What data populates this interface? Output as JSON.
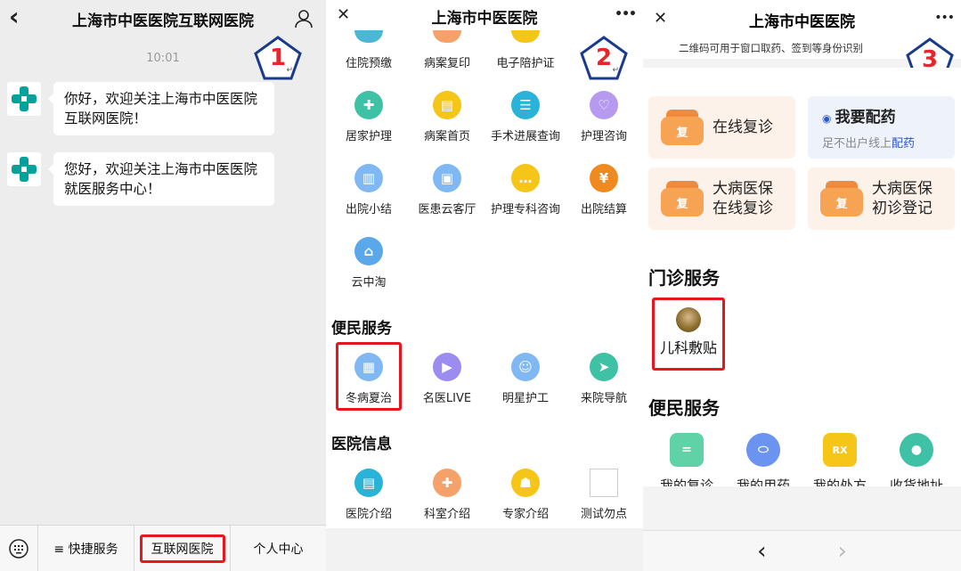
{
  "panel1": {
    "title": "上海市中医医院互联网医院",
    "back_icon": "‹",
    "user_icon": "user-icon",
    "badge_num": "1",
    "time": "10:01",
    "messages": [
      "你好，欢迎关注上海市中医医院互联网医院！",
      "您好，欢迎关注上海市中医医院就医服务中心！"
    ],
    "tabs": [
      "≡ 快捷服务",
      "互联网医院",
      "个人中心"
    ]
  },
  "panel2": {
    "title": "上海市中医医院",
    "close_icon": "✕",
    "more_icon": "•••",
    "badge_num": "2",
    "row0": [
      "住院预缴",
      "病案复印",
      "电子陪护证"
    ],
    "row1": [
      "居家护理",
      "病案首页",
      "手术进展查询",
      "护理咨询"
    ],
    "row2": [
      "出院小结",
      "医患云客厅",
      "护理专科咨询",
      "出院结算"
    ],
    "row3": [
      "云中淘"
    ],
    "section_conv": "便民服务",
    "conv": [
      "冬病夏治",
      "名医LIVE",
      "明星护工",
      "来院导航"
    ],
    "section_info": "医院信息",
    "info": [
      "医院介绍",
      "科室介绍",
      "专家介绍",
      "测试勿点"
    ]
  },
  "panel3": {
    "title": "上海市中医医院",
    "subtitle": "二维码可用于窗口取药、签到等身份识别",
    "close_icon": "✕",
    "more_icon": "•••",
    "badge_num": "3",
    "card1": "在线复诊",
    "card2_title": "我要配药",
    "card2_sub1": "足不出户线上",
    "card2_sub2": "配药",
    "card3_l1": "大病医保",
    "card3_l2": "在线复诊",
    "card4_l1": "大病医保",
    "card4_l2": "初诊登记",
    "fu": "复",
    "section_outpatient": "门诊服务",
    "ped": "儿科敷贴",
    "section_conv": "便民服务",
    "conv": [
      "我的复诊",
      "我的用药",
      "我的处方",
      "收货地址"
    ],
    "nav_back": "‹",
    "nav_fwd": "›"
  },
  "colors": {
    "accent_red": "#e6161e",
    "teal": "#00a29a",
    "orange": "#f6a354"
  }
}
